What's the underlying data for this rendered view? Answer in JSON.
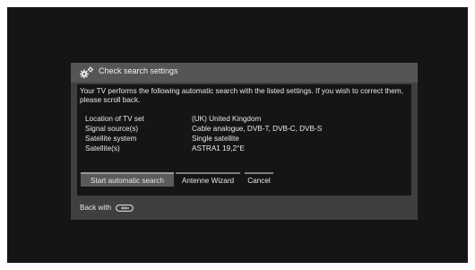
{
  "dialog": {
    "title": "Check search settings",
    "title_icon": "gear-icon",
    "intro": "Your TV performs the following automatic search with the listed settings. If you wish to correct them, please scroll back.",
    "settings": [
      {
        "label": "Location of TV set",
        "value": "(UK) United Kingdom"
      },
      {
        "label": "Signal source(s)",
        "value": "Cable analogue, DVB-T, DVB-C, DVB-S"
      },
      {
        "label": "Satellite system",
        "value": "Single satellite"
      },
      {
        "label": "Satellite(s)",
        "value": "ASTRA1 19,2°E"
      }
    ],
    "buttons": {
      "start": "Start automatic search",
      "wizard": "Antenne Wizard",
      "cancel": "Cancel"
    },
    "footer": {
      "back_label": "Back with",
      "back_icon": "back-button-icon"
    }
  },
  "colors": {
    "screen_background": "#151515",
    "dialog_frame": "#3f3f3f",
    "header": "#555555",
    "active_button": "#5a5a5a"
  }
}
